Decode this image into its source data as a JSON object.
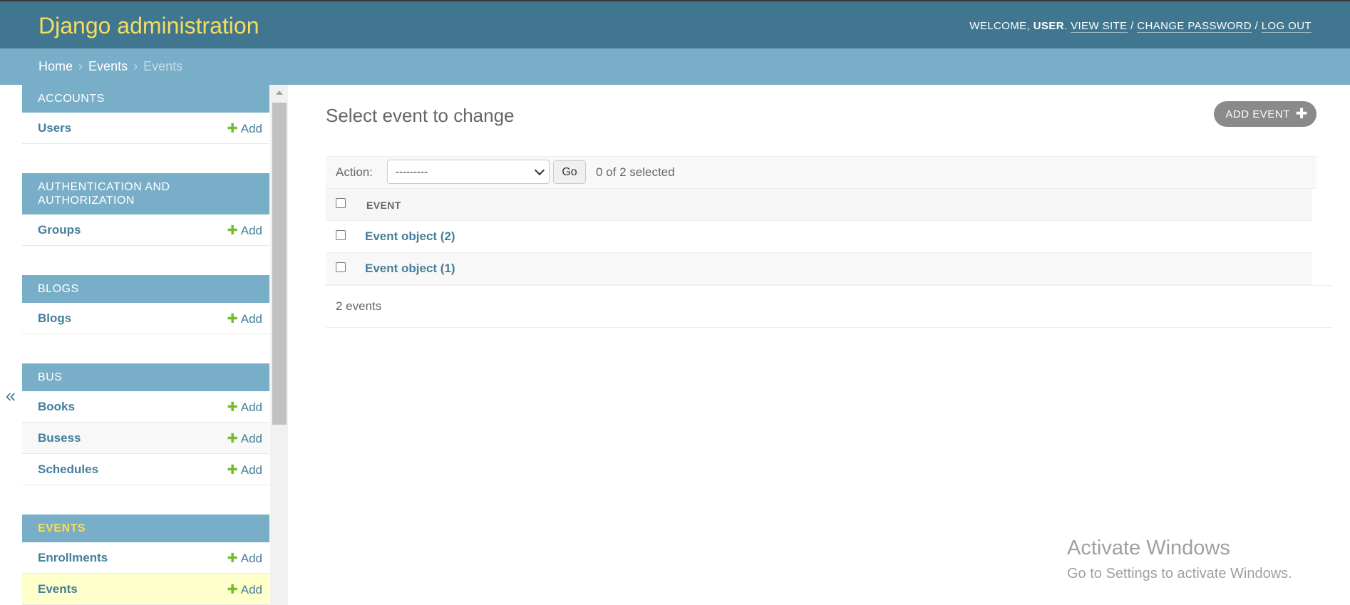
{
  "header": {
    "site_name": "Django administration",
    "welcome_prefix": "WELCOME, ",
    "username": "USER",
    "welcome_suffix": ". ",
    "view_site": "VIEW SITE",
    "change_password": "CHANGE PASSWORD",
    "log_out": "LOG OUT",
    "separator": " / "
  },
  "breadcrumbs": {
    "home": "Home",
    "app": "Events",
    "current": "Events",
    "separator": "›"
  },
  "sidebar": {
    "toggle": "«",
    "add_label": "Add",
    "modules": [
      {
        "caption": "ACCOUNTS",
        "models": [
          {
            "name": "Users"
          }
        ]
      },
      {
        "caption": "AUTHENTICATION AND AUTHORIZATION",
        "models": [
          {
            "name": "Groups"
          }
        ]
      },
      {
        "caption": "BLOGS",
        "models": [
          {
            "name": "Blogs"
          }
        ]
      },
      {
        "caption": "BUS",
        "models": [
          {
            "name": "Books"
          },
          {
            "name": "Busess"
          },
          {
            "name": "Schedules"
          }
        ]
      },
      {
        "caption": "EVENTS",
        "models": [
          {
            "name": "Enrollments"
          },
          {
            "name": "Events"
          }
        ]
      }
    ]
  },
  "main": {
    "title": "Select event to change",
    "add_button": "ADD EVENT",
    "actions": {
      "label": "Action:",
      "selected_option": "---------",
      "go_label": "Go",
      "selected_count": "0 of 2 selected"
    },
    "table": {
      "column_header": "EVENT",
      "rows": [
        "Event object (2)",
        "Event object (1)"
      ]
    },
    "paginator": "2 events"
  },
  "watermark": {
    "title": "Activate Windows",
    "subtitle": "Go to Settings to activate Windows."
  }
}
